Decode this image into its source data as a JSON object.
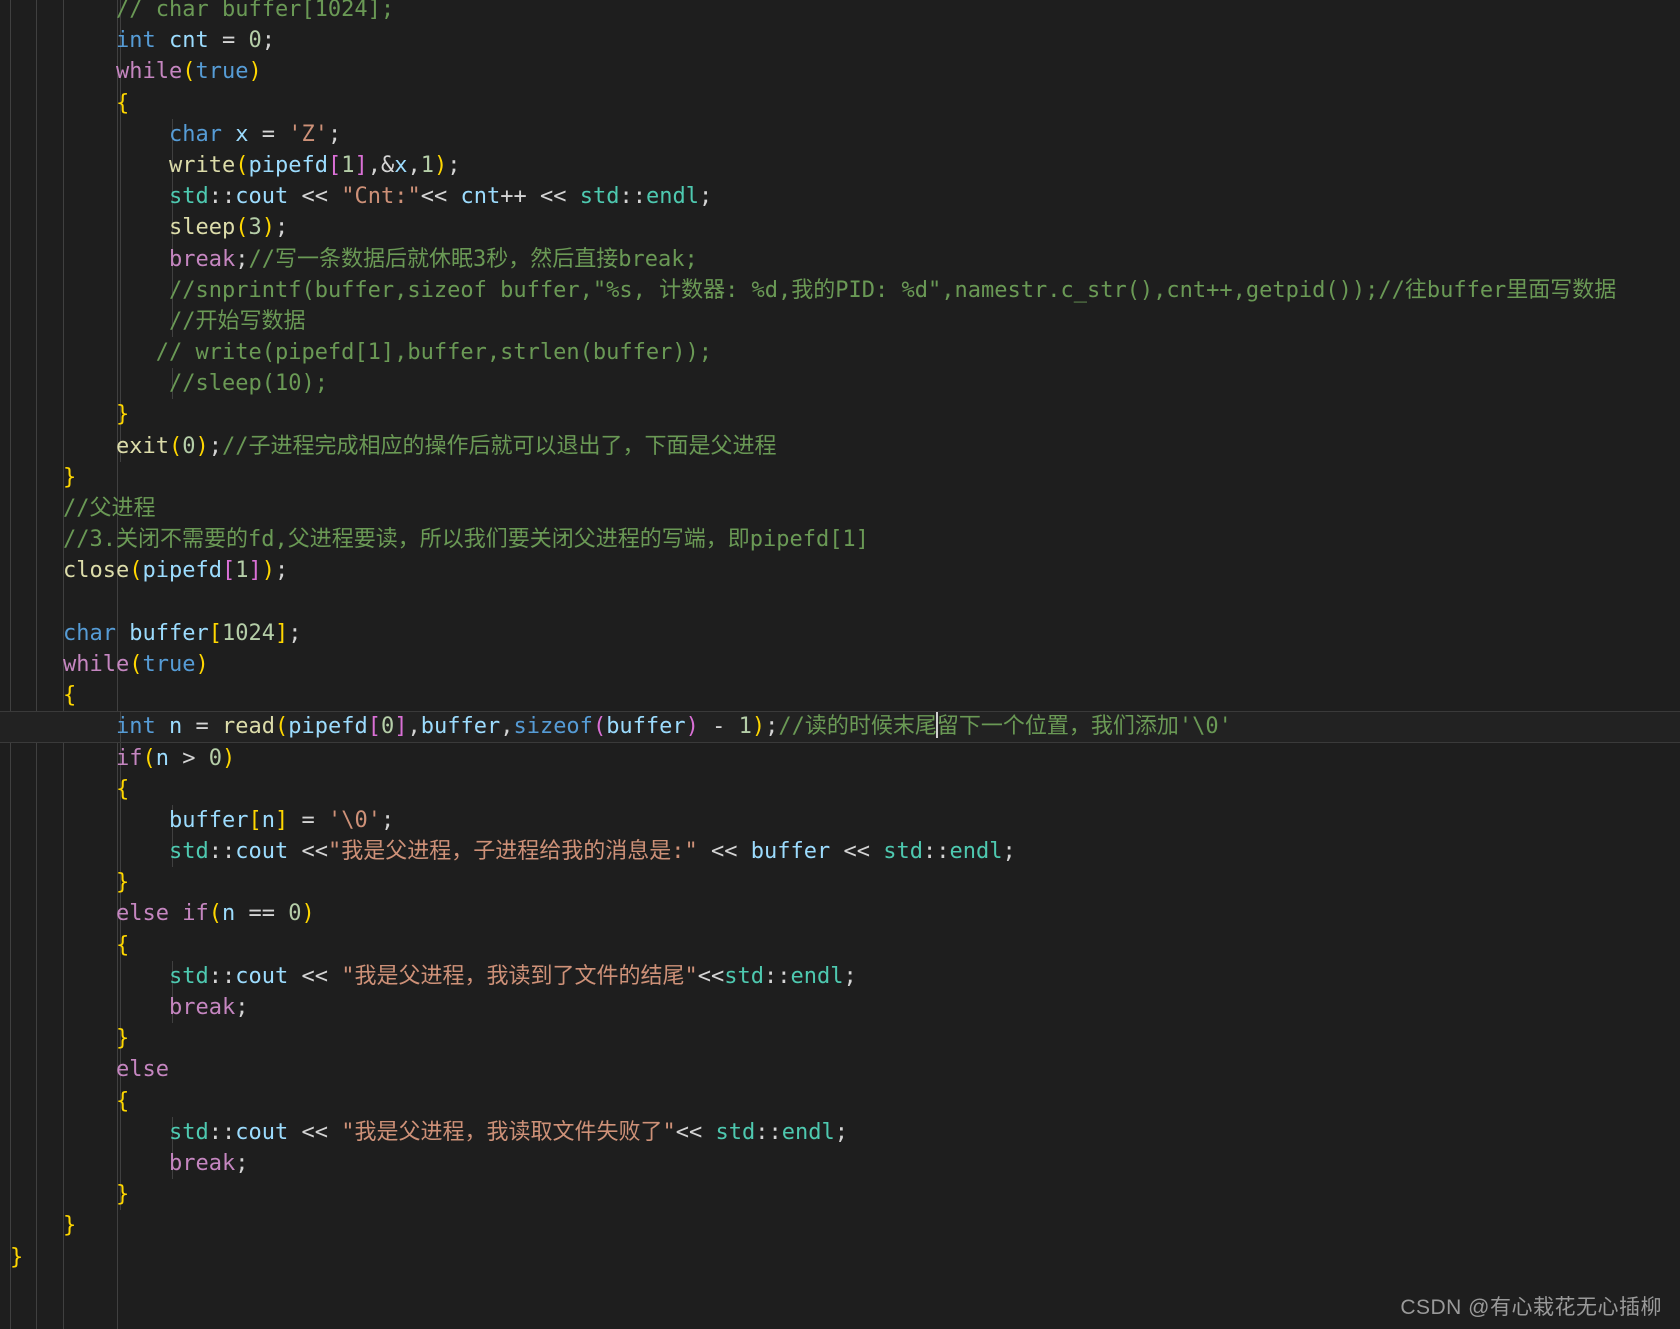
{
  "editor": {
    "background_color": "#1e1e1e",
    "active_line_color": "#222222",
    "font_size_px": 22,
    "caret_visible": true
  },
  "colors": {
    "comment": "#6a9955",
    "keyword": "#c586c0",
    "type": "#569cd6",
    "function": "#dcdcaa",
    "namespace": "#4ec9b0",
    "variable": "#9cdcfe",
    "number": "#b5cea8",
    "string": "#ce9178",
    "operator": "#d4d4d4",
    "bracket_1": "#ffd700",
    "bracket_2": "#da70d6",
    "bracket_3": "#179fff",
    "indent_guide": "#404040",
    "watermark": "#9a9a9a"
  },
  "code": {
    "language": "cpp",
    "active_line_index": 23,
    "caret_line_text_before": "        int n = read(pipefd[0],buffer,sizeof(buffer) - 1);//读的时候末尾",
    "caret_line_text_after": "留下一个位置，我们添加'\\0'",
    "lines": [
      "        // char buffer[1024];",
      "        int cnt = 0;",
      "        while(true)",
      "        {",
      "            char x = 'Z';",
      "            write(pipefd[1],&x,1);",
      "            std::cout << \"Cnt:\"<< cnt++ << std::endl;",
      "            sleep(3);",
      "            break;//写一条数据后就休眠3秒，然后直接break;",
      "            //snprintf(buffer,sizeof buffer,\"%s, 计数器: %d,我的PID: %d\",namestr.c_str(),cnt++,getpid());//往buffer里面写数据",
      "            //开始写数据",
      "           // write(pipefd[1],buffer,strlen(buffer));",
      "            //sleep(10);",
      "        }",
      "        exit(0);//子进程完成相应的操作后就可以退出了，下面是父进程",
      "    }",
      "    //父进程",
      "    //3.关闭不需要的fd,父进程要读，所以我们要关闭父进程的写端，即pipefd[1]",
      "    close(pipefd[1]);",
      "",
      "    char buffer[1024];",
      "    while(true)",
      "    {",
      "        int n = read(pipefd[0],buffer,sizeof(buffer) - 1);//读的时候末尾留下一个位置，我们添加'\\0'",
      "        if(n > 0)",
      "        {",
      "            buffer[n] = '\\0';",
      "            std::cout <<\"我是父进程，子进程给我的消息是:\" << buffer << std::endl;",
      "        }",
      "        else if(n == 0)",
      "        {",
      "            std::cout << \"我是父进程，我读到了文件的结尾\"<<std::endl;",
      "            break;",
      "        }",
      "        else",
      "        {",
      "            std::cout << \"我是父进程，我读取文件失败了\"<< std::endl;",
      "            break;",
      "        }",
      "    }",
      "}"
    ]
  },
  "watermark": {
    "text": "CSDN @有心栽花无心插柳"
  }
}
